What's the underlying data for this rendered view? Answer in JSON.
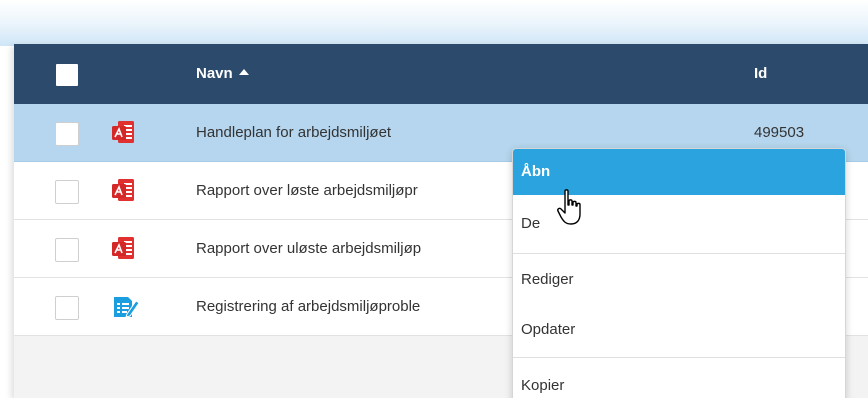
{
  "table": {
    "columns": {
      "name": "Navn",
      "id": "Id"
    },
    "sort": {
      "column": "name",
      "direction": "ascending"
    },
    "rows": [
      {
        "name": "Handleplan for arbejdsmiljøet",
        "id": "499503",
        "icon": "pdf-document-icon",
        "selected": true
      },
      {
        "name": "Rapport over løste arbejdsmiljøpr",
        "id": "",
        "icon": "pdf-document-icon",
        "selected": false
      },
      {
        "name": "Rapport over uløste arbejdsmiljøp",
        "id": "",
        "icon": "pdf-document-icon",
        "selected": false
      },
      {
        "name": "Registrering af arbejdsmiljøproble",
        "id": "",
        "icon": "form-edit-icon",
        "selected": false
      }
    ]
  },
  "context_menu": {
    "items": [
      {
        "label": "Åbn",
        "active": true
      },
      {
        "label": "De",
        "active": false
      },
      {
        "label": "Rediger",
        "active": false
      },
      {
        "label": "Opdater",
        "active": false
      },
      {
        "label": "Kopier",
        "active": false
      }
    ]
  },
  "colors": {
    "header_bg": "#2c4a6b",
    "selected_row_bg": "#b5d6ee",
    "menu_active_bg": "#2aa3de",
    "pdf_icon": "#e03030",
    "form_icon": "#1a9ee0"
  },
  "cursor": "hand-pointer-icon"
}
